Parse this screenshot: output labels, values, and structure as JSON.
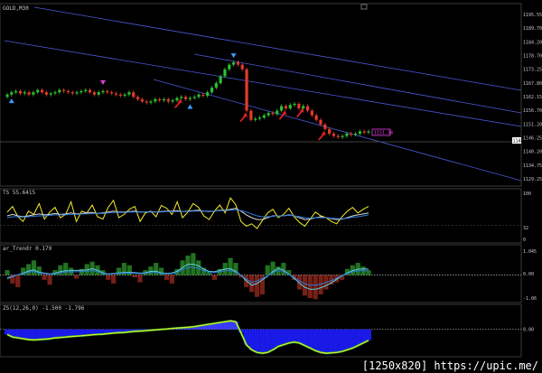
{
  "colors": {
    "background": "#000000",
    "bull_candle": "#2fbf2f",
    "bear_candle": "#e23b2b",
    "channel": "#4a5ad8",
    "grid": "#2a2a2a",
    "yellow": "#f5ee2a",
    "blue_line": "#2f7ad8",
    "cyan_line": "#5fd0e0",
    "white_line": "#d8d8d8",
    "green_hist": "#3ccf3c",
    "red_hist": "#d83a2a",
    "blue_hist": "#1a1ae8",
    "magenta": "#e040e0"
  },
  "chart_data": [
    {
      "type": "candlestick",
      "title": "GOLD,M30",
      "ylim": [
        1126,
        1203
      ],
      "y_ticks": [
        "1195.55",
        "1189.70",
        "1184.20",
        "1178.70",
        "1173.25",
        "1167.80",
        "1162.15",
        "1156.70",
        "1151.20",
        "1146.25",
        "1140.20",
        "1134.75",
        "1129.25"
      ],
      "current_price_label": "1148.20",
      "price_box_label": "1151.34",
      "close_series": [
        1165,
        1166,
        1166.5,
        1165.5,
        1166,
        1165,
        1166,
        1167,
        1166,
        1165,
        1165.5,
        1166,
        1167,
        1166.5,
        1166,
        1165.5,
        1166,
        1166.5,
        1167,
        1166,
        1165,
        1166,
        1166.5,
        1166,
        1165.5,
        1165,
        1164.5,
        1165,
        1166,
        1164,
        1163,
        1162,
        1161.5,
        1162,
        1163,
        1162.5,
        1163,
        1162,
        1162.5,
        1163.5,
        1164,
        1163,
        1163.5,
        1164,
        1165,
        1164.5,
        1166,
        1168,
        1170,
        1173,
        1176,
        1178,
        1179,
        1178,
        1176,
        1158,
        1154,
        1154.5,
        1155,
        1156,
        1157,
        1156.5,
        1158,
        1160,
        1159,
        1160.5,
        1161,
        1159,
        1160,
        1158,
        1156,
        1154,
        1152,
        1150,
        1148,
        1147,
        1146.5,
        1147,
        1148,
        1147.5,
        1148,
        1149,
        1148.5,
        1149
      ],
      "markers": [
        {
          "kind": "blue-up-arrow",
          "bar": 1
        },
        {
          "kind": "magenta-down-arrow",
          "bar": 22
        },
        {
          "kind": "blue-up-arrow",
          "bar": 42
        },
        {
          "kind": "red-arrow",
          "bar": 40
        },
        {
          "kind": "blue-down-arrow",
          "bar": 52
        },
        {
          "kind": "red-arrow",
          "bar": 55
        },
        {
          "kind": "red-arrow",
          "bar": 64
        },
        {
          "kind": "red-arrow",
          "bar": 68
        },
        {
          "kind": "red-arrow",
          "bar": 73
        }
      ]
    },
    {
      "type": "line",
      "title": "TS 55.6415",
      "ylim": [
        0,
        100
      ],
      "y_ticks": [
        "100",
        "32",
        "0"
      ],
      "series": [
        {
          "color": "yellow",
          "values": [
            60,
            72,
            50,
            40,
            62,
            55,
            78,
            45,
            60,
            70,
            48,
            55,
            82,
            40,
            62,
            58,
            75,
            50,
            45,
            70,
            85,
            48,
            55,
            66,
            72,
            40,
            58,
            62,
            50,
            74,
            68,
            55,
            82,
            48,
            60,
            78,
            70,
            52,
            44,
            62,
            75,
            58,
            90,
            76,
            40,
            30,
            35,
            25,
            42,
            58,
            66,
            48,
            55,
            68,
            50,
            38,
            30,
            45,
            60,
            52,
            48,
            40,
            35,
            50,
            62,
            70,
            58,
            66,
            72
          ]
        },
        {
          "color": "white_line",
          "values": [
            52,
            55,
            52,
            50,
            52,
            54,
            56,
            54,
            55,
            57,
            55,
            56,
            58,
            56,
            57,
            58,
            59,
            57,
            58,
            60,
            62,
            60,
            60,
            61,
            62,
            60,
            60,
            61,
            60,
            61,
            62,
            62,
            63,
            61,
            62,
            63,
            64,
            62,
            61,
            62,
            64,
            64,
            66,
            68,
            62,
            54,
            48,
            44,
            44,
            48,
            52,
            52,
            52,
            54,
            52,
            48,
            44,
            45,
            48,
            50,
            48,
            46,
            44,
            45,
            48,
            52,
            54,
            56,
            58
          ]
        },
        {
          "color": "blue_line",
          "values": [
            48,
            50,
            50,
            49,
            50,
            51,
            52,
            52,
            53,
            54,
            54,
            54,
            55,
            55,
            56,
            56,
            57,
            57,
            57,
            58,
            59,
            59,
            59,
            60,
            60,
            60,
            60,
            60,
            60,
            60,
            61,
            61,
            61,
            61,
            61,
            62,
            62,
            62,
            62,
            62,
            63,
            63,
            64,
            65,
            63,
            60,
            56,
            52,
            50,
            50,
            51,
            52,
            52,
            53,
            52,
            50,
            48,
            47,
            48,
            48,
            48,
            47,
            46,
            46,
            47,
            49,
            50,
            52,
            54
          ]
        }
      ]
    },
    {
      "type": "bar",
      "title": "ar_Trendr 0.179",
      "ylim": [
        -1.06,
        1.06
      ],
      "y_ticks": [
        "1.045",
        "0.00",
        "-1.06"
      ],
      "values": [
        0.2,
        -0.35,
        -0.5,
        0.3,
        0.45,
        0.6,
        0.35,
        -0.2,
        -0.4,
        0.2,
        0.4,
        0.5,
        0.3,
        -0.15,
        0.25,
        0.45,
        0.55,
        0.4,
        0.2,
        -0.2,
        -0.35,
        0.3,
        0.5,
        0.4,
        -0.1,
        -0.3,
        0.2,
        0.35,
        0.5,
        0.3,
        -0.2,
        -0.35,
        0.25,
        0.6,
        0.8,
        0.9,
        0.6,
        0.3,
        0.1,
        -0.2,
        0.25,
        0.5,
        0.7,
        0.5,
        -0.1,
        -0.5,
        -0.7,
        -0.9,
        -0.8,
        0.4,
        0.55,
        0.35,
        0.5,
        0.2,
        -0.2,
        -0.6,
        -0.85,
        -0.95,
        -1.0,
        -0.8,
        -0.6,
        -0.4,
        -0.3,
        -0.2,
        0.25,
        0.4,
        0.5,
        0.35,
        0.2
      ]
    },
    {
      "type": "area",
      "title": "ZS(12,26,0) -1.500 -1.796",
      "ylim": [
        -1.5,
        1.2
      ],
      "y_ticks": [
        "0.00"
      ],
      "values": [
        -0.3,
        -0.45,
        -0.5,
        -0.55,
        -0.6,
        -0.62,
        -0.6,
        -0.58,
        -0.55,
        -0.5,
        -0.48,
        -0.45,
        -0.42,
        -0.4,
        -0.38,
        -0.35,
        -0.32,
        -0.3,
        -0.28,
        -0.25,
        -0.22,
        -0.2,
        -0.18,
        -0.15,
        -0.12,
        -0.1,
        -0.08,
        -0.05,
        -0.03,
        0.0,
        0.02,
        0.05,
        0.08,
        0.1,
        0.12,
        0.15,
        0.2,
        0.25,
        0.3,
        0.35,
        0.4,
        0.45,
        0.5,
        0.45,
        -0.2,
        -0.9,
        -1.2,
        -1.35,
        -1.4,
        -1.35,
        -1.2,
        -1.0,
        -0.9,
        -0.8,
        -0.75,
        -0.8,
        -0.95,
        -1.1,
        -1.25,
        -1.35,
        -1.4,
        -1.38,
        -1.35,
        -1.3,
        -1.2,
        -1.1,
        -0.95,
        -0.8,
        -0.65
      ]
    }
  ],
  "watermark": "[1250x820] https://upic.me/"
}
